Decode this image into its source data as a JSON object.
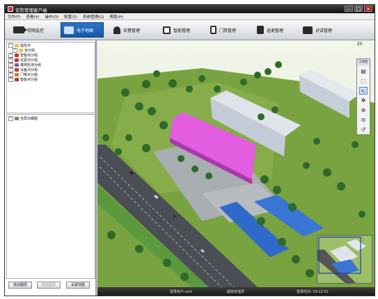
{
  "window": {
    "title": "安防管理客户端",
    "buttons": {
      "minimize": "–",
      "maximize": "□",
      "close": "×"
    }
  },
  "menu": [
    "文件(F)",
    "查看(V)",
    "操作(O)",
    "配置(S)",
    "系统管理(G)",
    "帮助(H)"
  ],
  "nav": [
    {
      "label": "视频监控",
      "icon": "camera-icon"
    },
    {
      "label": "电子地图",
      "icon": "map-icon",
      "active": true
    },
    {
      "label": "告警管理",
      "icon": "alarm-bell-icon"
    },
    {
      "label": "智能管理",
      "icon": "intelligence-icon"
    },
    {
      "label": "门禁管理",
      "icon": "door-access-icon"
    },
    {
      "label": "巡更管理",
      "icon": "patrol-icon"
    },
    {
      "label": "对讲管理",
      "icon": "intercom-icon"
    }
  ],
  "tree": {
    "root": "监控点",
    "items": [
      "未分组",
      "智警点分组",
      "巡更点分组",
      "离岗检测分组",
      "设备点分组",
      "门禁点分组",
      "智能点分组"
    ]
  },
  "map_tree": {
    "root": "全局鸟瞰图"
  },
  "left_buttons": {
    "add": "增加图层",
    "delete": "删除图层",
    "set": "设置地图"
  },
  "map": {
    "zoom": "25",
    "toolbox_title": "工具栏"
  },
  "tools": [
    "copy-icon",
    "select-icon",
    "pointer-icon",
    "move-icon",
    "zoom-in-icon",
    "zoom-out-icon",
    "undo-icon"
  ],
  "status": {
    "user": "登录用户:root",
    "role": "超级管理员",
    "time": "登录时间: 16:12:52"
  },
  "colors": {
    "accent": "#1a62b5",
    "highlight_building": "#e25ce0",
    "grass": "#6f9a3d"
  }
}
